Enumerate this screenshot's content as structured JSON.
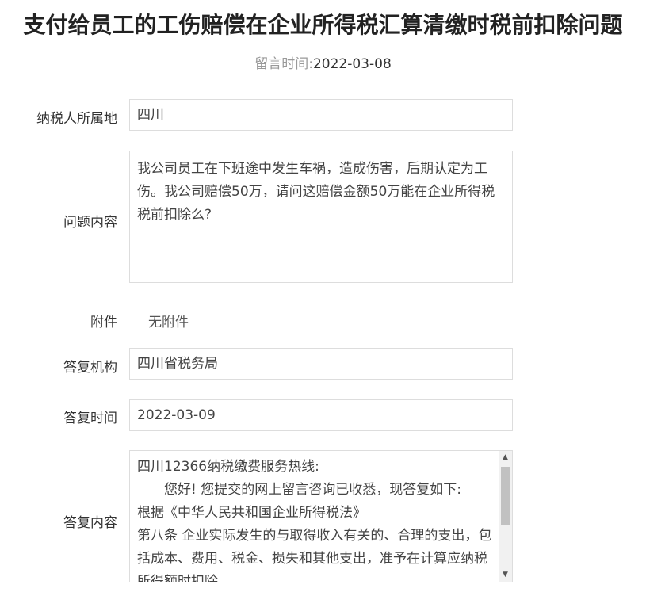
{
  "page": {
    "title": "支付给员工的工伤赔偿在企业所得税汇算清缴时税前扣除问题",
    "message_time_label": "留言时间:",
    "message_time_value": "2022-03-08"
  },
  "fields": {
    "region_label": "纳税人所属地",
    "region_value": "四川",
    "question_label": "问题内容",
    "question_value": "我公司员工在下班途中发生车祸，造成伤害，后期认定为工伤。我公司赔偿50万，请问这赔偿金额50万能在企业所得税税前扣除么?",
    "attachment_label": "附件",
    "attachment_value": "无附件",
    "org_label": "答复机构",
    "org_value": "四川省税务局",
    "reply_time_label": "答复时间",
    "reply_time_value": "2022-03-09",
    "reply_label": "答复内容",
    "reply_lines": [
      "四川12366纳税缴费服务热线:",
      "　　您好! 您提交的网上留言咨询已收悉，现答复如下:",
      "根据《中华人民共和国企业所得税法》",
      "第八条 企业实际发生的与取得收入有关的、合理的支出，包括成本、费用、税金、损失和其他支出，准予在计算应纳税所得额时扣除。"
    ]
  }
}
